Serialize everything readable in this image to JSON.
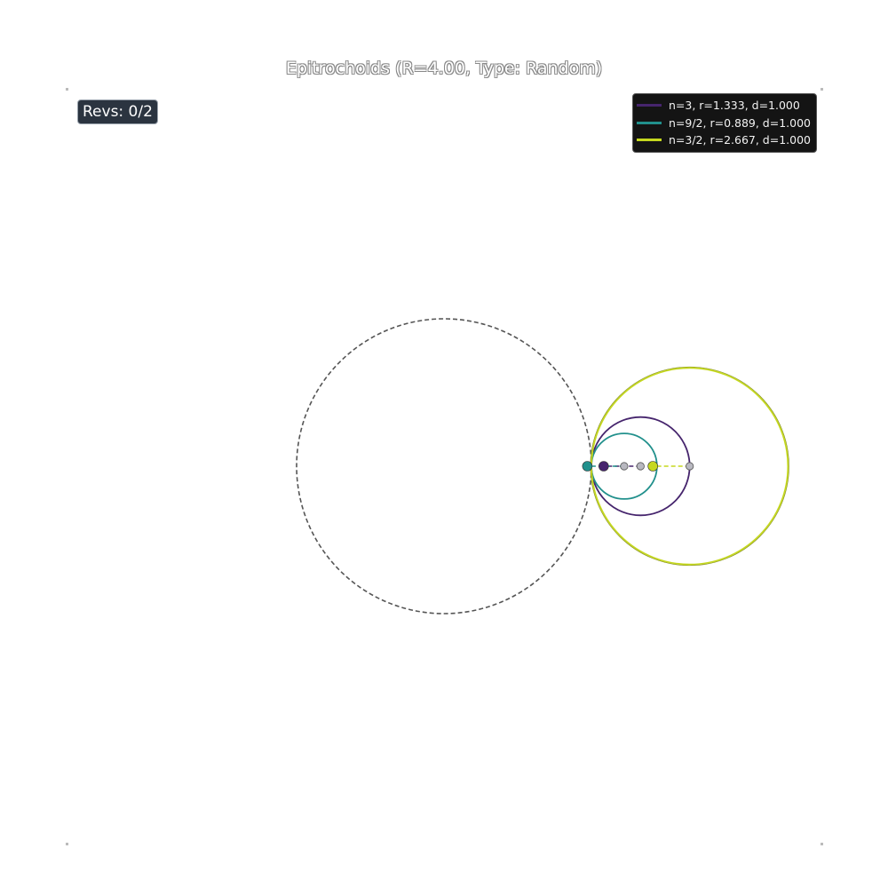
{
  "title": "Epitrochoids (R=4.00, Type: Random)",
  "revs_label": "Revs: 0/2",
  "fixed_circle": {
    "R": 4.0,
    "center": [
      0,
      0
    ],
    "stroke": "#555555"
  },
  "curves": [
    {
      "label": "n=3, r=1.333, d=1.000",
      "r": 1.333,
      "d": 1.0,
      "color": "#46256d"
    },
    {
      "label": "n=9/2, r=0.889, d=1.000",
      "r": 0.889,
      "d": 1.0,
      "color": "#21908c"
    },
    {
      "label": "n=3/2, r=2.667, d=1.000",
      "r": 2.667,
      "d": 1.0,
      "color": "#c5d81f"
    }
  ],
  "view": {
    "xlim": [
      -10.25,
      10.25
    ],
    "ylim": [
      -10.25,
      10.25
    ]
  }
}
